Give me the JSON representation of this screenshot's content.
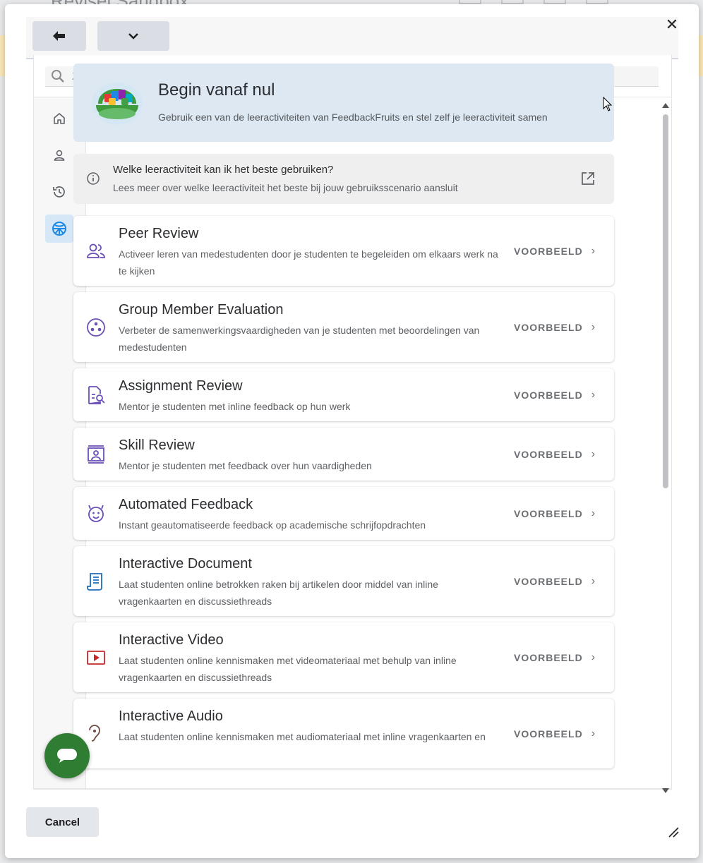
{
  "background": {
    "title": "Revisel Sandbox"
  },
  "modal": {
    "close_icon": "close-icon",
    "back_icon": "arrow-left-icon",
    "more_icon": "chevron-down-icon",
    "search": {
      "placeholder": "Zoek naar leeractiviteiten en sjablonen"
    },
    "sidebar": [
      {
        "icon": "home-icon",
        "active": false
      },
      {
        "icon": "user-icon",
        "active": false
      },
      {
        "icon": "history-icon",
        "active": false
      },
      {
        "icon": "fruit-basket-icon",
        "active": true
      }
    ],
    "hero": {
      "title": "Begin vanaf nul",
      "subtitle": "Gebruik een van de leeractiviteiten van FeedbackFruits en stel zelf je leeractiviteit samen"
    },
    "info": {
      "title": "Welke leeractiviteit kan ik het beste gebruiken?",
      "subtitle": "Lees meer over welke leeractiviteit het beste bij jouw gebruiksscenario aansluit"
    },
    "action_label": "VOORBEELD",
    "activities": [
      {
        "title": "Peer Review",
        "desc": "Activeer leren van medestudenten door je studenten te begeleiden om elkaars werk na te kijken",
        "icon": "peer-review-icon",
        "color": "#6a4fb6"
      },
      {
        "title": "Group Member Evaluation",
        "desc": "Verbeter de samenwerkingsvaardigheden van je studenten met beoordelingen van medestudenten",
        "icon": "group-evaluation-icon",
        "color": "#6a4fb6"
      },
      {
        "title": "Assignment Review",
        "desc": "Mentor je studenten met inline feedback op hun werk",
        "icon": "assignment-review-icon",
        "color": "#6a4fb6"
      },
      {
        "title": "Skill Review",
        "desc": "Mentor je studenten met feedback over hun vaardigheden",
        "icon": "skill-review-icon",
        "color": "#6a4fb6"
      },
      {
        "title": "Automated Feedback",
        "desc": "Instant geautomatiseerde feedback op academische schrijfopdrachten",
        "icon": "automated-feedback-icon",
        "color": "#6a4fb6"
      },
      {
        "title": "Interactive Document",
        "desc": "Laat studenten online betrokken raken bij artikelen door middel van inline vragenkaarten en discussiethreads",
        "icon": "interactive-document-icon",
        "color": "#1e6fb8"
      },
      {
        "title": "Interactive Video",
        "desc": "Laat studenten online kennismaken met videomateriaal met behulp van inline vragenkaarten en discussiethreads",
        "icon": "interactive-video-icon",
        "color": "#c62828"
      },
      {
        "title": "Interactive Audio",
        "desc": "Laat studenten online kennismaken met audiomateriaal met inline vragenkaarten en",
        "icon": "interactive-audio-icon",
        "color": "#6d4c41"
      }
    ],
    "cancel_label": "Cancel",
    "colors": {
      "accent": "#1e88e5",
      "active_bg": "#d6e8f8",
      "hero_bg": "#dde8f2",
      "chat": "#2e7d32"
    }
  }
}
